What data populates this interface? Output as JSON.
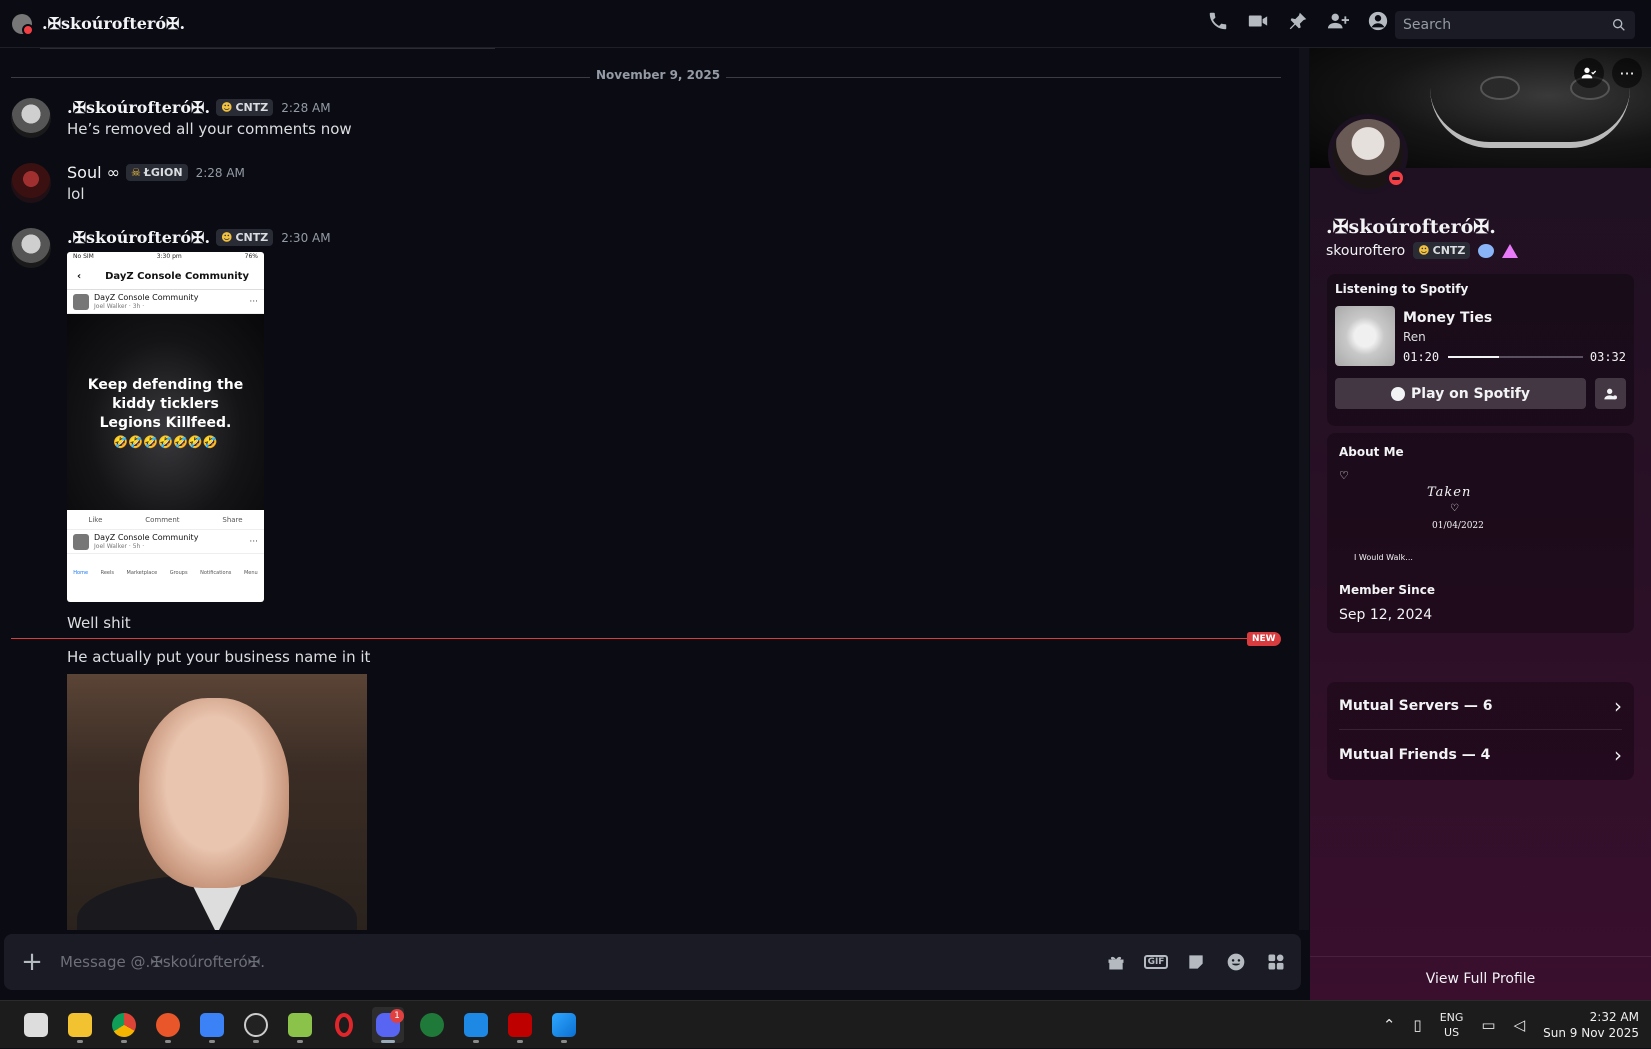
{
  "header": {
    "title": ".✠skoúrofteró✠.",
    "search_placeholder": "Search"
  },
  "chat": {
    "date_divider": "November 9, 2025",
    "messages": [
      {
        "author": ".✠skoúrofteró✠.",
        "tag": "CNTZ",
        "time": "2:28 AM",
        "text": "He’s removed all your comments now"
      },
      {
        "author": "Soul ∞",
        "tag": "ŁGION",
        "time": "2:28 AM",
        "text": "lol"
      },
      {
        "author": ".✠skoúrofteró✠.",
        "tag": "CNTZ",
        "time": "2:30 AM",
        "text": "Well shit"
      },
      {
        "text": "He actually put your business name in it"
      }
    ],
    "new_badge": "NEW",
    "embedded_screenshot": {
      "status_left": "No SIM",
      "status_time": "3:30 pm",
      "status_right": "76%",
      "group_name": "DayZ Console Community",
      "post_group": "DayZ Console Community",
      "post_author": "Joel Walker · 3h ·",
      "meme_text": "Keep defending the kiddy ticklers Legions Killfeed.",
      "meme_emoji": "🤣🤣🤣🤣🤣🤣🤣",
      "actions": [
        "Like",
        "Comment",
        "Share"
      ],
      "post2_group": "DayZ Console Community",
      "post2_author": "Joel Walker · 5h ·",
      "nav": [
        "Home",
        "Reels",
        "Marketplace",
        "Groups",
        "Notifications",
        "Menu"
      ]
    }
  },
  "composer": {
    "placeholder": "Message @.✠skoúrofteró✠.",
    "gif_label": "GIF"
  },
  "profile": {
    "display_name": ".✠skoúrofteró✠.",
    "username": "skouroftero",
    "tag": "CNTZ",
    "spotify": {
      "title": "Listening to Spotify",
      "song": "Money Ties",
      "artist": "Ren",
      "elapsed": "01:20",
      "duration": "03:32",
      "progress": 0.377,
      "play_label": "Play on Spotify"
    },
    "about": {
      "heading": "About Me",
      "heart": "♡",
      "taken": "Taken",
      "heart2": "♡",
      "date": "01/04/2022",
      "walk": "I Would Walk..."
    },
    "member_since_heading": "Member Since",
    "member_since": "Sep 12, 2024",
    "mutual_servers": "Mutual Servers — 6",
    "mutual_friends": "Mutual Friends — 4",
    "view_full": "View Full Profile"
  },
  "taskbar": {
    "discord_notifications": "1",
    "lang_line1": "ENG",
    "lang_line2": "US",
    "time": "2:32 AM",
    "date": "Sun 9 Nov 2025"
  }
}
